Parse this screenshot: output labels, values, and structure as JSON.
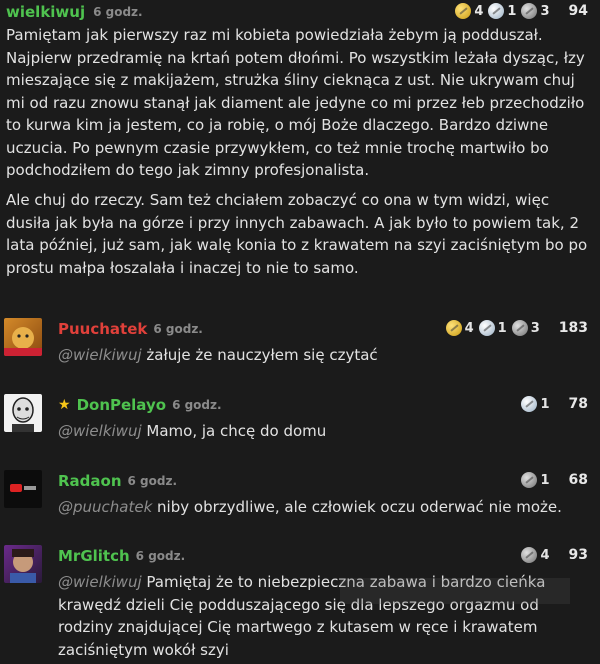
{
  "main_comment": {
    "author": "wielkiwuj",
    "time": "6 godz.",
    "awards": {
      "gold": "4",
      "silver": "1",
      "grey": "3"
    },
    "score": "94",
    "paragraph1": "Pamiętam jak pierwszy raz mi kobieta powiedziała żebym ją podduszał. Najpierw przedramię na krtań potem dłońmi. Po wszystkim leżała dysząc, łzy mieszające się z makijażem, strużka śliny cieknąca z ust. Nie ukrywam chuj mi od razu znowu stanął jak diament ale jedyne co mi przez łeb przechodziło to kurwa kim ja jestem, co ja robię, o mój Boże dlaczego. Bardzo dziwne uczucia. Po pewnym czasie przywykłem, co też mnie trochę martwiło bo podchodziłem do tego jak zimny profesjonalista.",
    "paragraph2": "Ale chuj do rzeczy. Sam też chciałem zobaczyć co ona w tym widzi, więc dusiła jak była na górze i przy innych zabawach. A jak było to powiem tak, 2 lata później, już sam, jak walę konia to z krawatem na szyi zaciśniętym bo po prostu małpa łoszalała i inaczej to nie to samo."
  },
  "replies": [
    {
      "author": "Puuchatek",
      "time": "6 godz.",
      "color": "#e0403a",
      "star": "",
      "mention": "@wielkiwuj",
      "text": " żałuje że nauczyłem się czytać",
      "awards": {
        "gold": "4",
        "silver": "1",
        "grey": "3"
      },
      "score": "183"
    },
    {
      "author": "DonPelayo",
      "time": "6 godz.",
      "color": "#4fc34f",
      "star": "★",
      "mention": "@wielkiwuj",
      "text": " Mamo, ja chcę do domu",
      "awards": {
        "silver": "1"
      },
      "score": "78"
    },
    {
      "author": "Radaon",
      "time": "6 godz.",
      "color": "#4fc34f",
      "star": "",
      "mention": "@puuchatek",
      "text": " niby obrzydliwe, ale człowiek oczu oderwać nie może.",
      "awards": {
        "grey": "1"
      },
      "score": "68"
    },
    {
      "author": "MrGlitch",
      "time": "6 godz.",
      "color": "#4fc34f",
      "star": "",
      "mention": "@wielkiwuj",
      "text": " Pamiętaj że to niebezpieczna zabawa i bardzo cieńka krawędź dzieli Cię podduszającego się dla lepszego orgazmu od rodziny znajdującej Cię martwego z kutasem w ręce i krawatem zaciśniętym wokół szyi",
      "awards": {
        "grey": "4"
      },
      "score": "93"
    }
  ],
  "colors": {
    "background": "#1b1b1b",
    "main_author": "#4fc34f",
    "text": "#e2e2e2",
    "muted": "#8a8a8a"
  }
}
